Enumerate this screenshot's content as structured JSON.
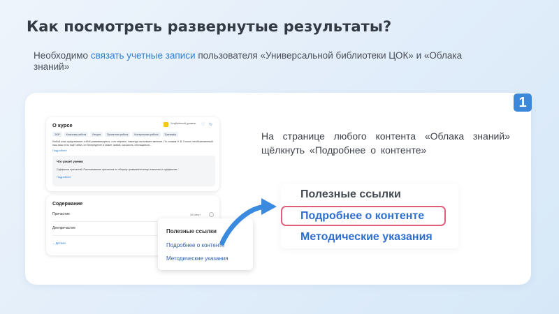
{
  "slide": {
    "title": "Как посмотреть развернутые результаты?",
    "intro_prefix": "Необходимо ",
    "intro_link": "связать учетные записи",
    "intro_suffix": " пользователя «Универсальной библиотеки ЦОК» и «Облака знаний»",
    "step_number": "1",
    "instruction": "На странице любого контента «Облака знаний» щёлкнуть «Подробнее о контенте»"
  },
  "course_card": {
    "title": "О курсе",
    "level": "Углублённый уровень",
    "heart_icon": "heart-icon",
    "share_icon": "share-icon",
    "chips": [
      "ЭОР",
      "Классная работа",
      "Лекция",
      "Проектная работа",
      "Контрольная работа",
      "Тренажёр"
    ],
    "description": "Любой язык представляет собой развивающееся, а не мёртвое, навсегда застывшее явление. По словам Н. В. Гоголя «необыкновенный наш язык есть ещё тайна, он беспределен и может, живой, как жизнь, обогащаться...",
    "more": "Подробнее",
    "learn_title": "Что узнает ученик",
    "learn_text": "Суффиксы причастий. Распознавание причастия по общему грамматическому значению и суффиксам...",
    "learn_more": "Подробнее"
  },
  "contents_card": {
    "title": "Содержание",
    "item1": "Причастие",
    "item1_time": "150 минут",
    "item2": "Деепричастие",
    "details": "Детали"
  },
  "popup_small": {
    "title": "Полезные ссылки",
    "link1": "Подробнее о контенте",
    "link2": "Методические указания"
  },
  "popup_zoom": {
    "title": "Полезные ссылки",
    "link1": "Подробнее о контенте",
    "link2": "Методические указания"
  },
  "colors": {
    "accent": "#2d7fd6",
    "highlight_border": "#e05e7e",
    "badge": "#3b87d9",
    "arrow": "#3a8ae0"
  }
}
